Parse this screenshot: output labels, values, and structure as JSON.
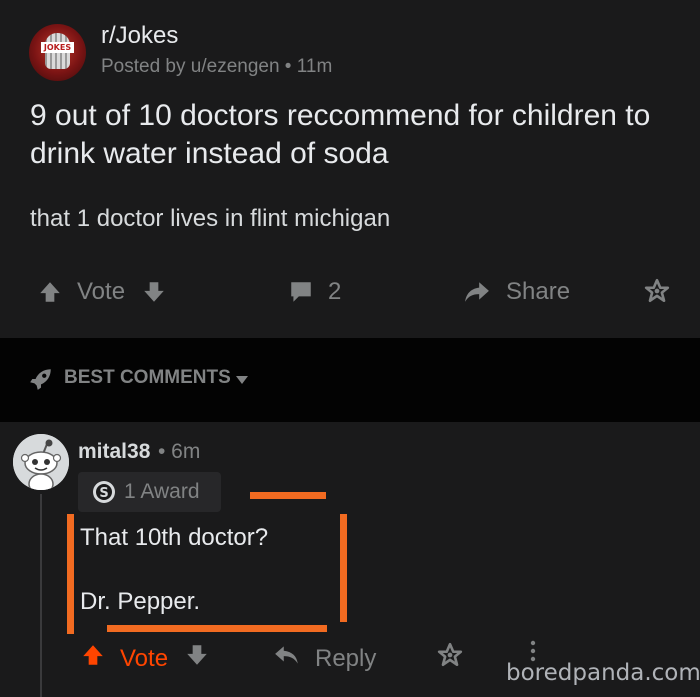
{
  "post": {
    "subreddit": "r/Jokes",
    "posted_by": "Posted by u/ezengen • 11m",
    "avatar_text": "JOKES",
    "title": "9 out of 10 doctors reccommend for children to drink water instead of soda",
    "body": "that 1 doctor lives in flint michigan",
    "actions": {
      "vote_label": "Vote",
      "comment_count": "2",
      "share_label": "Share"
    }
  },
  "sort": {
    "label": "BEST COMMENTS"
  },
  "comment": {
    "username": "mital38",
    "time": "• 6m",
    "award_label": "1 Award",
    "line1": "That 10th doctor?",
    "line2": "Dr. Pepper.",
    "actions": {
      "vote_label": "Vote",
      "reply_label": "Reply"
    }
  },
  "watermark": "boredpanda.com",
  "colors": {
    "background": "#1a1a1b",
    "sort_bar": "#030303",
    "upvote_orange": "#ff4500",
    "annotation_orange": "#f26b21",
    "muted_text": "#818384"
  },
  "icons": {
    "upvote": "arrow-up-icon",
    "downvote": "arrow-down-icon",
    "comment": "comment-bubble-icon",
    "share": "share-arrow-icon",
    "award": "award-star-icon",
    "sort": "rocket-icon",
    "dropdown": "caret-down-icon",
    "reply": "reply-arrow-icon",
    "more": "more-vertical-icon",
    "silver_award": "silver-award-icon"
  }
}
